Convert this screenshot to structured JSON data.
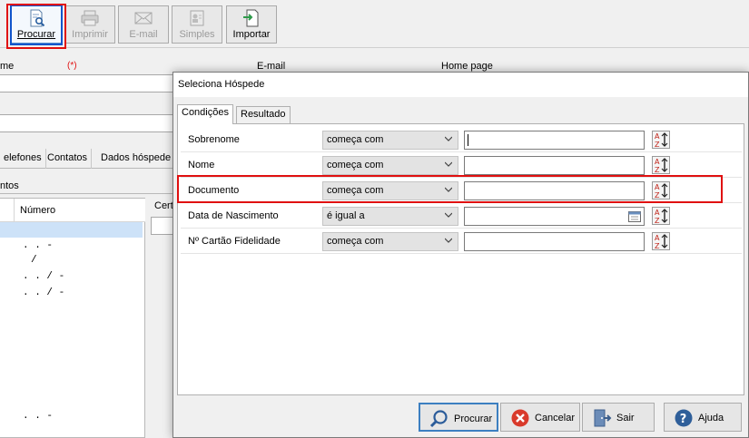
{
  "toolbar": {
    "buttons": [
      {
        "label": "Procurar",
        "enabled": true,
        "icon": "search-document-icon"
      },
      {
        "label": "Imprimir",
        "enabled": false,
        "icon": "printer-icon"
      },
      {
        "label": "E-mail",
        "enabled": false,
        "icon": "envelope-icon"
      },
      {
        "label": "Simples",
        "enabled": false,
        "icon": "contact-card-icon"
      },
      {
        "label": "Importar",
        "enabled": true,
        "icon": "import-document-icon"
      }
    ]
  },
  "background_form": {
    "labels": {
      "name_partial": "me",
      "required_mark": "(*)",
      "email": "E-mail",
      "homepage": "Home page"
    },
    "tabs": [
      "elefones",
      "Contatos",
      "Dados hóspede"
    ],
    "subtab": "ntos",
    "grid_header": "Número",
    "side_label": "Cert",
    "grid_rows": [
      " .  .  -",
      "  /",
      " .  .  /  -",
      " .  .  /  -",
      " .  .  -"
    ]
  },
  "dialog": {
    "title": "Seleciona Hóspede",
    "tabs": [
      "Condições",
      "Resultado"
    ],
    "active_tab": 0,
    "rows": [
      {
        "label": "Sobrenome",
        "operator": "começa com",
        "value": ""
      },
      {
        "label": "Nome",
        "operator": "começa com",
        "value": ""
      },
      {
        "label": "Documento",
        "operator": "começa com",
        "value": ""
      },
      {
        "label": "Data de Nascimento",
        "operator": "é igual a",
        "value": ""
      },
      {
        "label": "Nº Cartão Fidelidade",
        "operator": "começa com",
        "value": ""
      }
    ],
    "footer": {
      "search": "Procurar",
      "cancel": "Cancelar",
      "exit": "Sair",
      "help": "Ajuda"
    }
  },
  "colors": {
    "highlight_red": "#e01010",
    "highlight_blue": "#1155cc",
    "selected_row": "#cde2f8",
    "accent": "#3c7fc1"
  }
}
